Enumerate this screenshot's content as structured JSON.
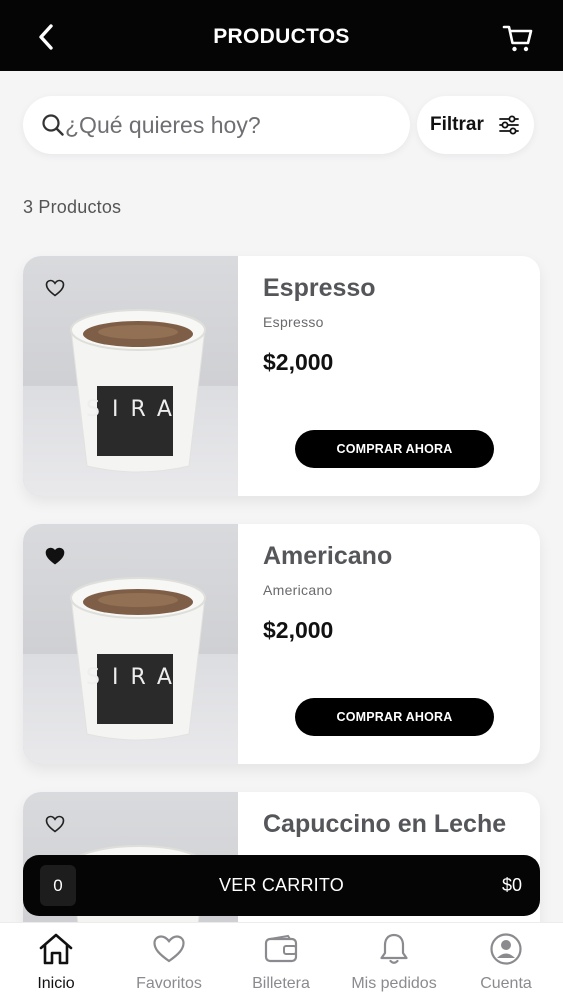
{
  "header": {
    "title": "PRODUCTOS",
    "back_icon": "chevron-left-icon",
    "cart_icon": "cart-icon"
  },
  "search": {
    "placeholder": "¿Qué quieres hoy?",
    "value": ""
  },
  "filter": {
    "label": "Filtrar"
  },
  "results": {
    "count_text": "3 Productos"
  },
  "products": [
    {
      "name": "Espresso",
      "subtitle": "Espresso",
      "price": "$2,000",
      "button": "COMPRAR AHORA",
      "favorite": false
    },
    {
      "name": "Americano",
      "subtitle": "Americano",
      "price": "$2,000",
      "button": "COMPRAR AHORA",
      "favorite": true
    },
    {
      "name": "Capuccino en Leche",
      "subtitle": "",
      "price": "",
      "button": "",
      "favorite": false
    }
  ],
  "cart_bar": {
    "qty": "0",
    "label": "VER CARRITO",
    "total": "$0"
  },
  "tabs": [
    {
      "label": "Inicio",
      "icon": "home-icon",
      "active": true
    },
    {
      "label": "Favoritos",
      "icon": "heart-icon",
      "active": false
    },
    {
      "label": "Billetera",
      "icon": "wallet-icon",
      "active": false
    },
    {
      "label": "Mis pedidos",
      "icon": "bell-icon",
      "active": false
    },
    {
      "label": "Cuenta",
      "icon": "user-icon",
      "active": false
    }
  ],
  "cup_print": "SIRA",
  "colors": {
    "header_bg": "#050505",
    "accent": "#000000",
    "background": "#f5f5f6",
    "inactive_tab": "#8b8b8f"
  }
}
